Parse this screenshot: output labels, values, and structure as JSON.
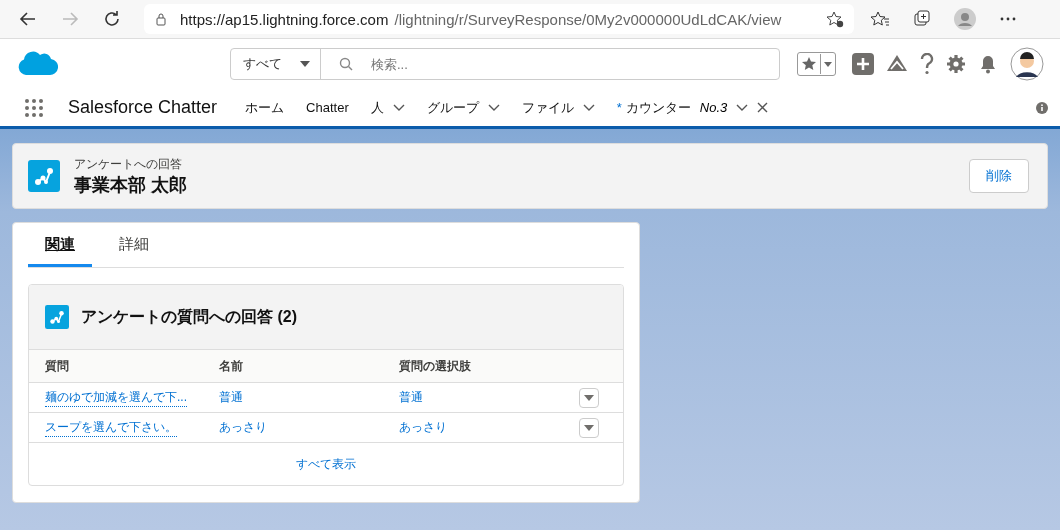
{
  "browser": {
    "url_host": "https://ap15.lightning.force.com",
    "url_path": "/lightning/r/SurveyResponse/0My2v000000UdLdCAK/view"
  },
  "header": {
    "scope": "すべて",
    "search": {
      "placeholder": "検索..."
    }
  },
  "app": {
    "name": "Salesforce Chatter"
  },
  "nav": [
    {
      "label": "ホーム",
      "menu": false,
      "kind": "item"
    },
    {
      "label": "Chatter",
      "menu": false,
      "kind": "item"
    },
    {
      "label": "人",
      "menu": true,
      "kind": "item"
    },
    {
      "label": "グループ",
      "menu": true,
      "kind": "item"
    },
    {
      "label": "ファイル",
      "menu": true,
      "kind": "item"
    },
    {
      "label": "カウンター",
      "sub": "No.3",
      "menu": true,
      "kind": "record",
      "mark": "*"
    }
  ],
  "record": {
    "type": "アンケートへの回答",
    "title": "事業本部 太郎",
    "button": "削除"
  },
  "tabs": [
    {
      "label": "関連",
      "selected": true
    },
    {
      "label": "詳細",
      "selected": false
    }
  ],
  "related": {
    "title": "アンケートの質問への回答 (2)",
    "columns": [
      "質問",
      "名前",
      "質問の選択肢"
    ],
    "rows": [
      {
        "cells": [
          "麺のゆで加減を選んで下...",
          "普通",
          "普通"
        ]
      },
      {
        "cells": [
          "スープを選んで下さい。",
          "あっさり",
          "あっさり"
        ]
      }
    ],
    "view_all": "すべて表示"
  }
}
